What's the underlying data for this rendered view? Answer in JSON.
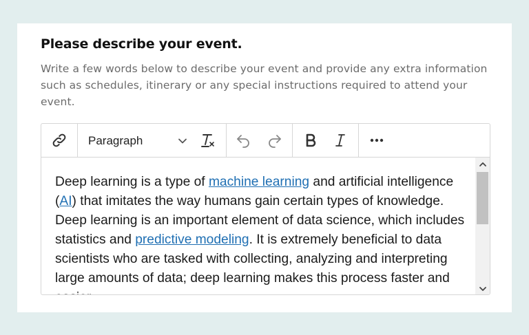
{
  "form": {
    "title": "Please describe your event.",
    "description": "Write a few words below to describe your event and provide any extra information such as schedules, itinerary or any special instructions required to attend your event."
  },
  "toolbar": {
    "link_icon": "link-icon",
    "format_select": {
      "selected": "Paragraph"
    },
    "clear_format_icon": "clear-formatting-icon",
    "undo_icon": "undo-icon",
    "redo_icon": "redo-icon",
    "bold_icon": "bold-icon",
    "italic_icon": "italic-icon",
    "more_icon": "more-icon"
  },
  "content": {
    "segments": [
      {
        "text": "Deep learning is a type of "
      },
      {
        "text": "machine learning",
        "link": true
      },
      {
        "text": " and artificial intelligence ("
      },
      {
        "text": "AI",
        "link": true
      },
      {
        "text": ") that imitates the way humans gain certain types of knowledge. Deep learning is an important element of data science, which includes statistics and "
      },
      {
        "text": "predictive modeling",
        "link": true
      },
      {
        "text": ". It is extremely beneficial to data scientists who are tasked with collecting, analyzing and interpreting large amounts of data; deep learning makes this process faster and easier."
      }
    ]
  },
  "colors": {
    "page_background": "#e2eeee",
    "link": "#1f6fb3",
    "border": "#d6d6d6"
  }
}
